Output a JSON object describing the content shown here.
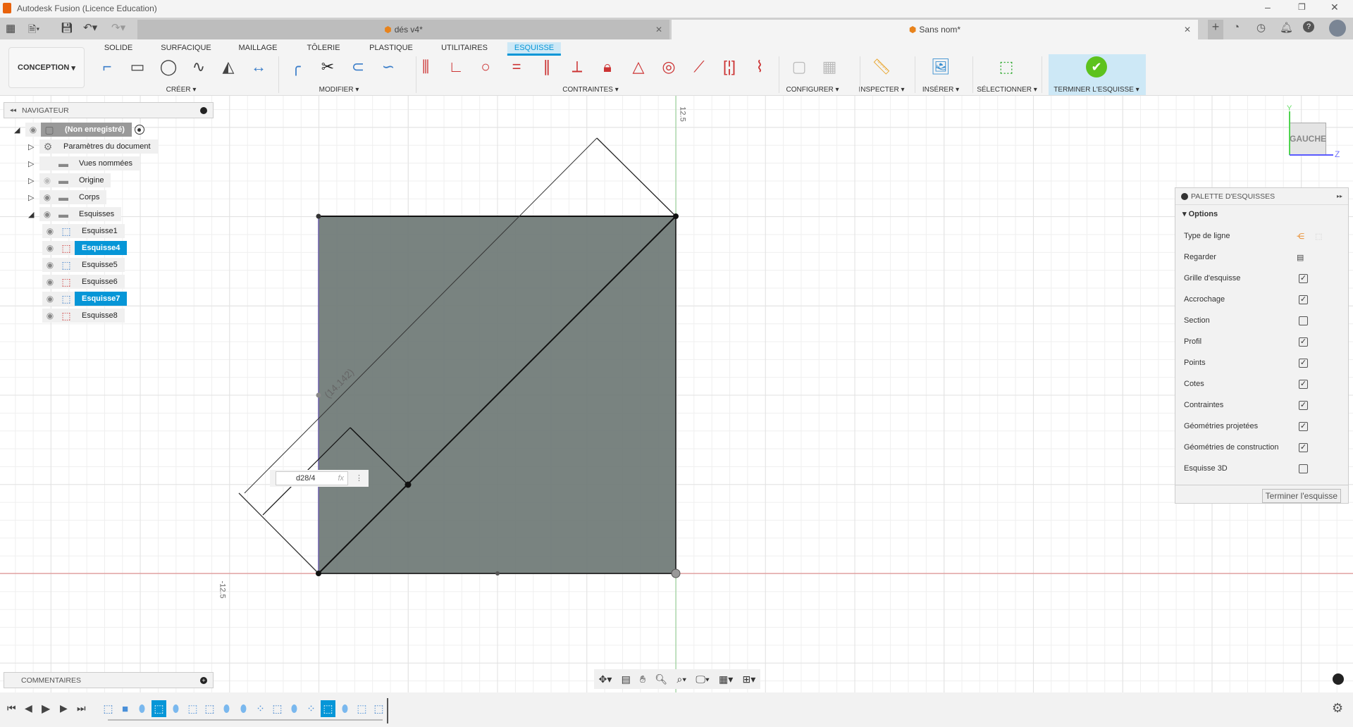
{
  "window": {
    "title": "Autodesk Fusion (Licence Education)",
    "controls": [
      "minimize",
      "restore",
      "close"
    ]
  },
  "doc_tabs": [
    {
      "label": "dés v4*",
      "active": false
    },
    {
      "label": "Sans nom*",
      "active": true
    }
  ],
  "ribbon": {
    "workspace": "CONCEPTION",
    "tabs": [
      "SOLIDE",
      "SURFACIQUE",
      "MAILLAGE",
      "TÔLERIE",
      "PLASTIQUE",
      "UTILITAIRES",
      "ESQUISSE"
    ],
    "active_tab": "ESQUISSE",
    "groups": [
      {
        "label": "CRÉER",
        "icons": [
          "line-icon",
          "rectangle-icon",
          "circle-icon",
          "spline-icon",
          "mirror-icon",
          "dimension-icon"
        ]
      },
      {
        "label": "MODIFIER",
        "icons": [
          "fillet-icon",
          "trim-icon",
          "offset-icon",
          "curve-icon"
        ]
      },
      {
        "label": "CONTRAINTES",
        "icons": [
          "horizontal-vertical-icon",
          "coincident-icon",
          "tangent-icon",
          "equal-icon",
          "parallel-icon",
          "perpendicular-icon",
          "fix-icon",
          "midpoint-icon",
          "concentric-icon",
          "collinear-icon",
          "symmetry-icon",
          "curvature-icon"
        ]
      },
      {
        "label": "CONFIGURER",
        "icons": [
          "configure-icon",
          "table-icon"
        ]
      },
      {
        "label": "INSPECTER",
        "icons": [
          "measure-icon"
        ]
      },
      {
        "label": "INSÉRER",
        "icons": [
          "insert-image-icon"
        ]
      },
      {
        "label": "SÉLECTIONNER",
        "icons": [
          "select-icon"
        ]
      },
      {
        "label": "TERMINER L'ESQUISSE",
        "icons": [
          "finish-sketch-check-icon"
        ]
      }
    ],
    "accent": "#0696d7"
  },
  "navigator": {
    "title": "NAVIGATEUR",
    "items": [
      {
        "label": "(Non enregistré)",
        "level": 0,
        "type": "root"
      },
      {
        "label": "Paramètres du document",
        "level": 1,
        "type": "gear"
      },
      {
        "label": "Vues nommées",
        "level": 1,
        "type": "folder"
      },
      {
        "label": "Origine",
        "level": 1,
        "type": "folder",
        "hidden": true
      },
      {
        "label": "Corps",
        "level": 1,
        "type": "folder"
      },
      {
        "label": "Esquisses",
        "level": 1,
        "type": "folder",
        "expanded": true
      },
      {
        "label": "Esquisse1",
        "level": 2,
        "type": "sketch"
      },
      {
        "label": "Esquisse4",
        "level": 2,
        "type": "sketch-locked",
        "selected": true
      },
      {
        "label": "Esquisse5",
        "level": 2,
        "type": "sketch"
      },
      {
        "label": "Esquisse6",
        "level": 2,
        "type": "sketch-locked"
      },
      {
        "label": "Esquisse7",
        "level": 2,
        "type": "sketch",
        "selected": true
      },
      {
        "label": "Esquisse8",
        "level": 2,
        "type": "sketch-locked"
      }
    ]
  },
  "comments": {
    "title": "COMMENTAIRES"
  },
  "canvas": {
    "axis_label_top": "12.5",
    "axis_label_left": "-12.5",
    "dimension_text": "(14.142)",
    "dimension_input": {
      "value": "d28/4",
      "fx": "fx"
    },
    "viewcube": {
      "face": "GAUCHE",
      "axis_y": "Y",
      "axis_z": "Z"
    },
    "profile_color": "#6f7a76"
  },
  "palette": {
    "title": "PALETTE D'ESQUISSES",
    "section": "Options",
    "rows": [
      {
        "label": "Type de ligne",
        "kind": "icons"
      },
      {
        "label": "Regarder",
        "kind": "icon"
      },
      {
        "label": "Grille d'esquisse",
        "checked": true
      },
      {
        "label": "Accrochage",
        "checked": true
      },
      {
        "label": "Section",
        "checked": false
      },
      {
        "label": "Profil",
        "checked": true
      },
      {
        "label": "Points",
        "checked": true
      },
      {
        "label": "Cotes",
        "checked": true
      },
      {
        "label": "Contraintes",
        "checked": true
      },
      {
        "label": "Géométries projetées",
        "checked": true
      },
      {
        "label": "Géométries de construction",
        "checked": true
      },
      {
        "label": "Esquisse 3D",
        "checked": false
      }
    ],
    "finish_button": "Terminer l'esquisse"
  },
  "timeline": {
    "items": [
      "sketch",
      "body",
      "extrude",
      "sketch-active",
      "extrude",
      "rect",
      "sketch",
      "extrude",
      "extrude",
      "pattern",
      "sketch",
      "extrude",
      "pattern",
      "sketch-active",
      "extrude",
      "rect",
      "sketch"
    ]
  }
}
